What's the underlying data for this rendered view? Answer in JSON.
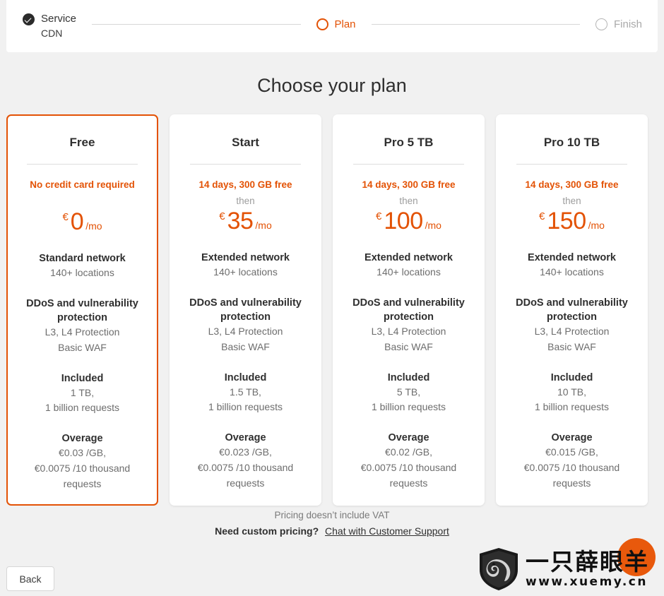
{
  "stepper": {
    "steps": [
      {
        "label": "Service",
        "sublabel": "CDN",
        "state": "done"
      },
      {
        "label": "Plan",
        "sublabel": "",
        "state": "active"
      },
      {
        "label": "Finish",
        "sublabel": "",
        "state": "todo"
      }
    ]
  },
  "main": {
    "title": "Choose your plan"
  },
  "plans": [
    {
      "name": "Free",
      "selected": true,
      "promo": "No credit card required",
      "then": "",
      "currency": "€",
      "amount": "0",
      "period": "/mo",
      "network_title": "Standard network",
      "network_line": "140+ locations",
      "protection_title": "DDoS and vulnerability protection",
      "protection_lines": [
        "L3, L4 Protection",
        "Basic WAF"
      ],
      "included_title": "Included",
      "included_lines": [
        "1 TB,",
        "1 billion requests"
      ],
      "overage_title": "Overage",
      "overage_lines": [
        "€0.03 /GB,",
        "€0.0075 /10 thousand requests"
      ]
    },
    {
      "name": "Start",
      "selected": false,
      "promo": "14 days, 300 GB free",
      "then": "then",
      "currency": "€",
      "amount": "35",
      "period": "/mo",
      "network_title": "Extended network",
      "network_line": "140+ locations",
      "protection_title": "DDoS and vulnerability protection",
      "protection_lines": [
        "L3, L4 Protection",
        "Basic WAF"
      ],
      "included_title": "Included",
      "included_lines": [
        "1.5 TB,",
        "1 billion requests"
      ],
      "overage_title": "Overage",
      "overage_lines": [
        "€0.023 /GB,",
        "€0.0075 /10 thousand requests"
      ]
    },
    {
      "name": "Pro 5 TB",
      "selected": false,
      "promo": "14 days, 300 GB free",
      "then": "then",
      "currency": "€",
      "amount": "100",
      "period": "/mo",
      "network_title": "Extended network",
      "network_line": "140+ locations",
      "protection_title": "DDoS and vulnerability protection",
      "protection_lines": [
        "L3, L4 Protection",
        "Basic WAF"
      ],
      "included_title": "Included",
      "included_lines": [
        "5 TB,",
        "1 billion requests"
      ],
      "overage_title": "Overage",
      "overage_lines": [
        "€0.02 /GB,",
        "€0.0075 /10 thousand requests"
      ]
    },
    {
      "name": "Pro 10 TB",
      "selected": false,
      "promo": "14 days, 300 GB free",
      "then": "then",
      "currency": "€",
      "amount": "150",
      "period": "/mo",
      "network_title": "Extended network",
      "network_line": "140+ locations",
      "protection_title": "DDoS and vulnerability protection",
      "protection_lines": [
        "L3, L4 Protection",
        "Basic WAF"
      ],
      "included_title": "Included",
      "included_lines": [
        "10 TB,",
        "1 billion requests"
      ],
      "overage_title": "Overage",
      "overage_lines": [
        "€0.015 /GB,",
        "€0.0075 /10 thousand requests"
      ]
    }
  ],
  "notes": {
    "vat": "Pricing doesn’t include VAT",
    "custom_question": "Need custom pricing?",
    "support_link": "Chat with Customer Support"
  },
  "footer": {
    "back_label": "Back"
  },
  "watermark": {
    "chinese": "一只薛眼羊",
    "url": "www.xuemy.cn"
  },
  "colors": {
    "accent": "#e35205",
    "chat_button": "#e8590c",
    "page_background": "#f1f1f1",
    "card_background": "#ffffff",
    "muted_text": "#6d6d6d"
  }
}
